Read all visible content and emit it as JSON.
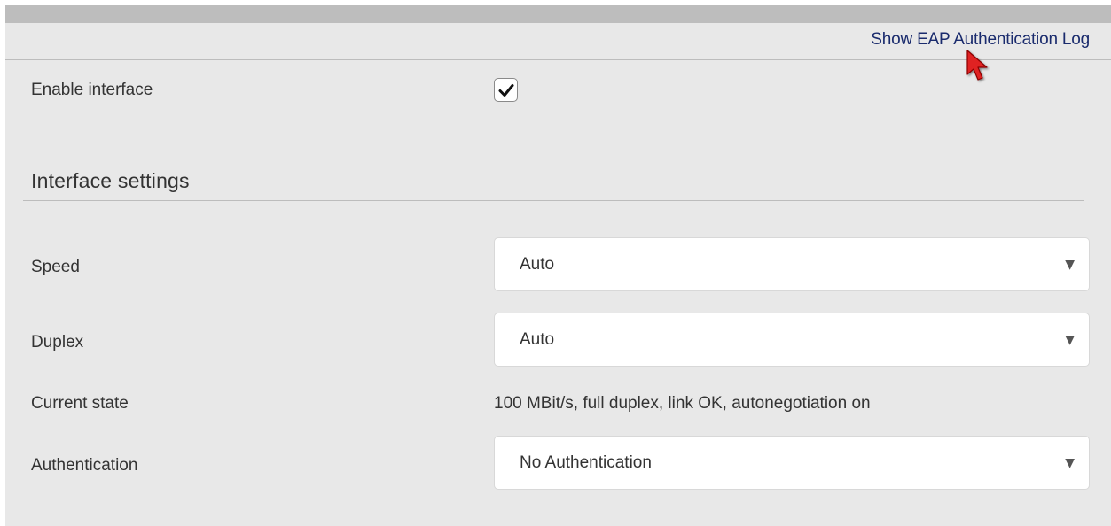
{
  "header": {
    "eap_log_link": "Show EAP Authentication Log"
  },
  "enable_interface": {
    "label": "Enable interface",
    "checked": true
  },
  "section": {
    "title": "Interface settings"
  },
  "speed": {
    "label": "Speed",
    "value": "Auto"
  },
  "duplex": {
    "label": "Duplex",
    "value": "Auto"
  },
  "current_state": {
    "label": "Current state",
    "value": "100 MBit/s, full duplex, link OK, autonegotiation on"
  },
  "authentication": {
    "label": "Authentication",
    "value": "No Authentication"
  },
  "icons": {
    "checkmark": "checkmark-icon",
    "dropdown": "dropdown-arrow-icon",
    "cursor": "mouse-pointer-icon"
  },
  "colors": {
    "link": "#1a2b6d",
    "panel_bg": "#e8e8e8",
    "cursor": "#e02020"
  }
}
